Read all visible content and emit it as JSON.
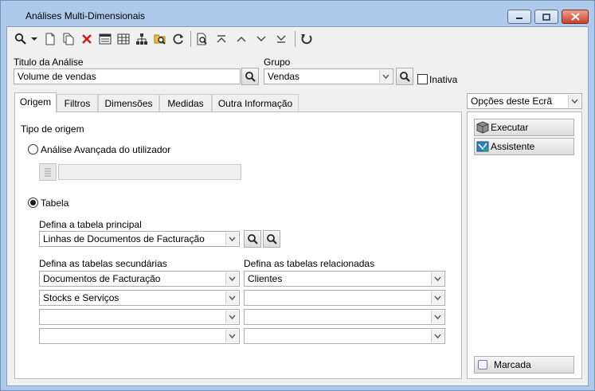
{
  "window": {
    "title": "Análises Multi-Dimensionais"
  },
  "toolbar": {
    "icons": [
      "search-icon",
      "dropdown-arrow-icon",
      "new-document-icon",
      "copy-document-icon",
      "delete-icon",
      "properties-icon",
      "grid-icon",
      "hierarchy-icon",
      "folder-search-icon",
      "refresh-icon",
      "print-preview-icon",
      "first-record-icon",
      "previous-record-icon",
      "next-record-icon",
      "last-record-icon",
      "undo-icon"
    ]
  },
  "form": {
    "titulo_label": "Titulo da Análise",
    "titulo_value": "Volume de vendas",
    "grupo_label": "Grupo",
    "grupo_value": "Vendas",
    "inativa_label": "Inativa",
    "inativa_checked": false
  },
  "tabs": [
    {
      "label": "Origem",
      "active": true
    },
    {
      "label": "Filtros",
      "active": false
    },
    {
      "label": "Dimensões",
      "active": false
    },
    {
      "label": "Medidas",
      "active": false
    },
    {
      "label": "Outra Informação",
      "active": false
    }
  ],
  "origem": {
    "tipo_label": "Tipo de origem",
    "radio_avancada": "Análise Avançada do utilizador",
    "radio_avancada_checked": false,
    "avancada_value": "",
    "radio_tabela": "Tabela",
    "radio_tabela_checked": true,
    "principal_label": "Defina a tabela principal",
    "principal_value": "Linhas de Documentos de Facturação",
    "secundarias_label": "Defina as tabelas secundárias",
    "relacionadas_label": "Defina as tabelas relacionadas",
    "secundarias": [
      "Documentos de Facturação",
      "Stocks e Serviços",
      "",
      ""
    ],
    "relacionadas": [
      "Clientes",
      "",
      "",
      ""
    ]
  },
  "side": {
    "opcoes_label": "Opções deste Ecrã",
    "executar_label": "Executar",
    "assistente_label": "Assistente",
    "marcada_label": "Marcada",
    "marcada_checked": false
  },
  "colors": {
    "frame": "#afc9ea",
    "client": "#f0f0f0",
    "close_button": "#c8412c"
  }
}
